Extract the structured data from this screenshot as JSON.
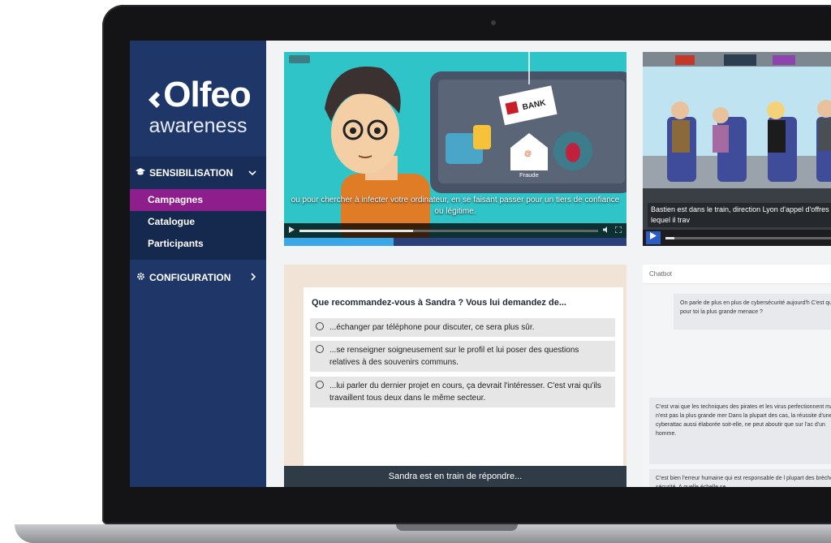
{
  "sidebar": {
    "logo_main": "Olfeo",
    "logo_sub": "awareness",
    "sections": [
      {
        "label": "SENSIBILISATION",
        "items": [
          "Campagnes",
          "Catalogue",
          "Participants"
        ],
        "active": "Campagnes"
      },
      {
        "label": "CONFIGURATION"
      }
    ]
  },
  "video1": {
    "bank_sign": "BANK",
    "fraud_label": "Fraude",
    "subtitle": "ou pour chercher à infecter votre ordinateur, en se faisant passer pour un tiers de confiance ou légitime."
  },
  "video2": {
    "subtitle": "Bastien est dans le train, direction Lyon d'appel d'offres sur lequel il trav"
  },
  "quiz": {
    "question": "Que recommandez-vous à Sandra ? Vous lui demandez de...",
    "options": [
      "...échanger par téléphone pour discuter, ce sera plus sûr.",
      "...se renseigner soigneusement sur le profil et lui poser des questions relatives à des souvenirs communs.",
      "...lui parler du dernier projet en cours, ça devrait l'intéresser. C'est vrai qu'ils travaillent tous deux dans le même secteur."
    ],
    "footer": "Sandra est en train de répondre..."
  },
  "chat": {
    "title": "Chatbot",
    "messages": [
      "On parle de plus en plus de cybersécurité aujourd'h C'est quoi pour toi la plus grande menace ?",
      "C'est vrai que les techniques des pirates et les virus perfectionnent mais ce n'est pas la plus grande mer Dans la plupart des cas, la réussite d'une cyberattac aussi élaborée soit-elle, ne peut aboutir que sur l'ac d'un homme.",
      "C'est bien l'erreur humaine qui est responsable de l plupart des brèches de sécurité. A quelle échelle se"
    ]
  },
  "colors": {
    "sidebar": "#1f3768",
    "active_item": "#8e1e8c",
    "video_bg": "#2ec4c8"
  }
}
